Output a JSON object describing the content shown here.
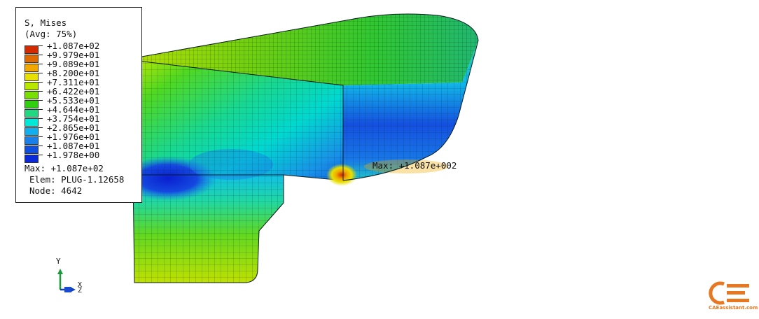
{
  "legend": {
    "title_line1": "S, Mises",
    "title_line2": "(Avg: 75%)",
    "values": [
      "+1.087e+02",
      "+9.979e+01",
      "+9.089e+01",
      "+8.200e+01",
      "+7.311e+01",
      "+6.422e+01",
      "+5.533e+01",
      "+4.644e+01",
      "+3.754e+01",
      "+2.865e+01",
      "+1.976e+01",
      "+1.087e+01",
      "+1.978e+00"
    ],
    "colors": [
      "#d42a00",
      "#e06a00",
      "#f0a800",
      "#e8e000",
      "#b8e800",
      "#78e000",
      "#30d010",
      "#20d880",
      "#00e8d8",
      "#10b0f0",
      "#1880e8",
      "#1050e0",
      "#0a2ad8"
    ],
    "max_line": "Max: +1.087e+02",
    "elem_line": "Elem: PLUG-1.12658",
    "node_line": "Node: 4642"
  },
  "viewport": {
    "max_annotation": "Max: +1.087e+002"
  },
  "triad": {
    "y_label": "Y",
    "x_label": "X",
    "z_label": "Z",
    "colors": {
      "x": "#1040c0",
      "y": "#1a9a3a",
      "z": "#1a4ad0"
    }
  },
  "watermark": {
    "text": "CAEassistant.com",
    "color": "#e87722",
    "icon": "cae-logo-icon"
  }
}
